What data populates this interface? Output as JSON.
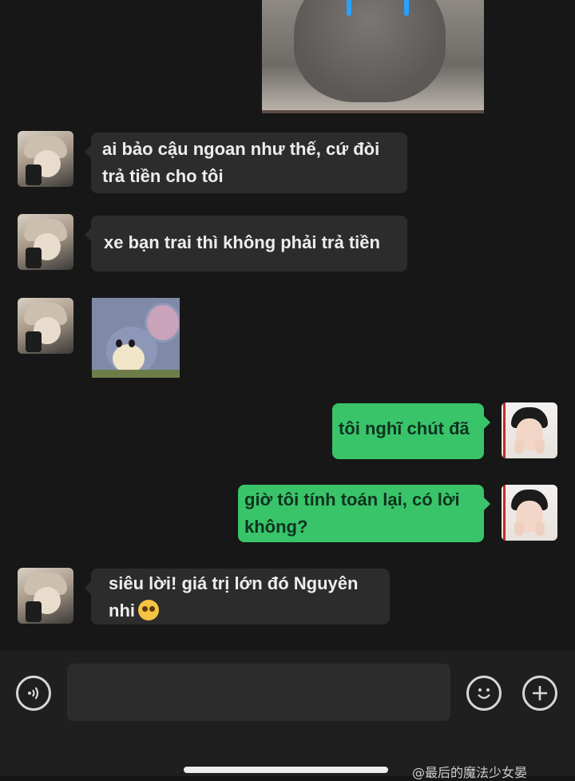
{
  "messages": [
    {
      "side": "in",
      "text": "ai bảo cậu ngoan như thế, cứ đòi trả tiền cho tôi"
    },
    {
      "side": "in",
      "text": "xe bạn trai thì không phải trả tiền"
    },
    {
      "side": "in",
      "type": "sticker",
      "sticker": "mouse-sticker"
    },
    {
      "side": "out",
      "text": "tôi nghĩ chút đã"
    },
    {
      "side": "out",
      "text": "giờ tôi tính toán lại, có lời không?"
    },
    {
      "side": "in",
      "text": "siêu lời! giá trị lớn đó Nguyên nhi",
      "emoji": "flushed-face-icon"
    }
  ],
  "icons": {
    "voice": "voice-icon",
    "emoji": "emoji-smile-icon",
    "add": "plus-icon"
  },
  "watermark": "@最后的魔法少女晏",
  "colors": {
    "background": "#171717",
    "incoming_bubble": "#2c2c2c",
    "outgoing_bubble": "#39c46a",
    "bottom_bar": "#1f1f1f"
  }
}
